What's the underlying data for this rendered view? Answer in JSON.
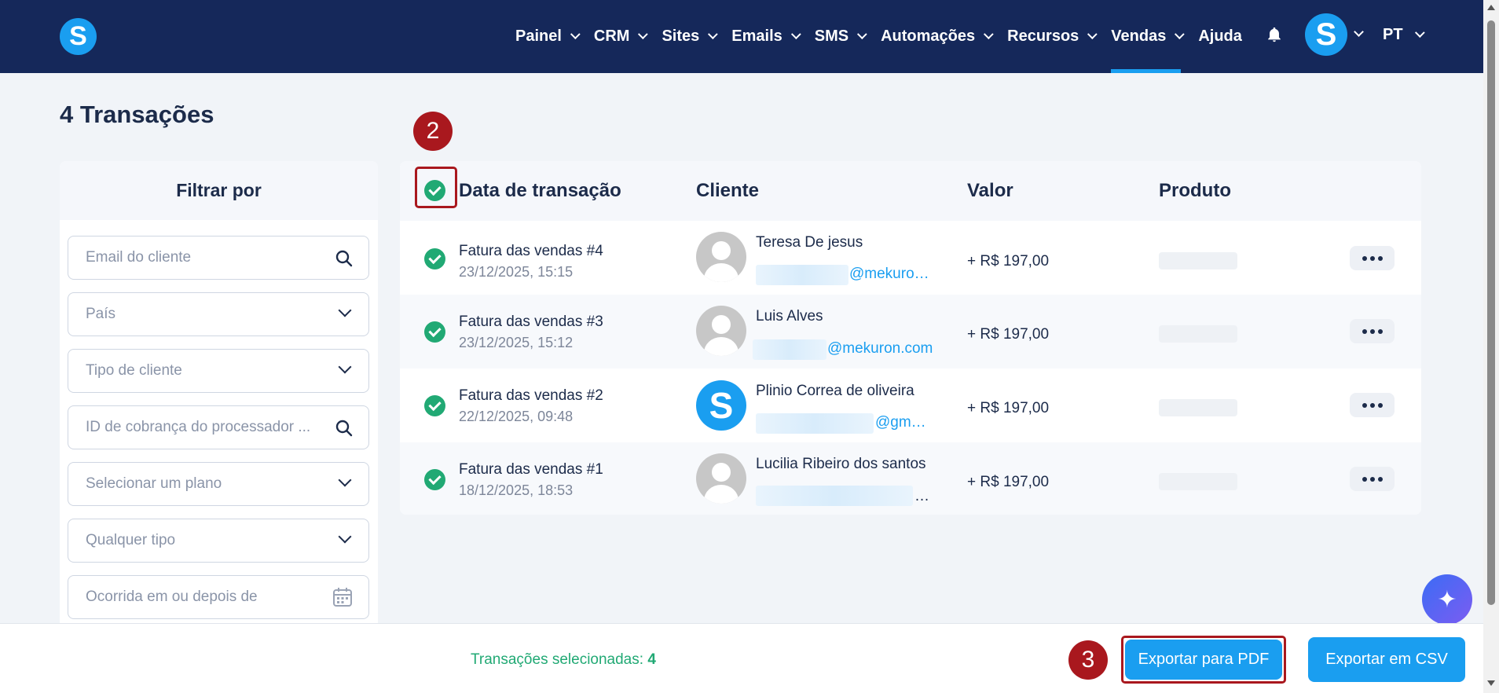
{
  "app": {
    "logo_letter": "S"
  },
  "nav": {
    "items": [
      {
        "label": "Painel",
        "has_menu": true
      },
      {
        "label": "CRM",
        "has_menu": true
      },
      {
        "label": "Sites",
        "has_menu": true
      },
      {
        "label": "Emails",
        "has_menu": true
      },
      {
        "label": "SMS",
        "has_menu": true
      },
      {
        "label": "Automações",
        "has_menu": true
      },
      {
        "label": "Recursos",
        "has_menu": true
      },
      {
        "label": "Vendas",
        "has_menu": true,
        "active": true
      },
      {
        "label": "Ajuda",
        "has_menu": false
      }
    ],
    "avatar_letter": "S",
    "language": "PT"
  },
  "page": {
    "title": "4 Transações"
  },
  "filter": {
    "heading": "Filtrar por",
    "fields": [
      {
        "placeholder": "Email do cliente",
        "icon": "search-icon"
      },
      {
        "placeholder": "País",
        "icon": "chevron-down-icon"
      },
      {
        "placeholder": "Tipo de cliente",
        "icon": "chevron-down-icon"
      },
      {
        "placeholder": "ID de cobrança do processador ...",
        "icon": "search-icon"
      },
      {
        "placeholder": "Selecionar um plano",
        "icon": "chevron-down-icon"
      },
      {
        "placeholder": "Qualquer tipo",
        "icon": "chevron-down-icon"
      },
      {
        "placeholder": "Ocorrida em ou depois de",
        "icon": "calendar-icon"
      }
    ]
  },
  "table": {
    "headers": {
      "date": "Data de transação",
      "client": "Cliente",
      "value": "Valor",
      "product": "Produto"
    },
    "rows": [
      {
        "title": "Fatura das vendas #4",
        "date": "23/12/2025, 15:15",
        "client_name": "Teresa De jesus",
        "client_email": "@mekuro…",
        "avatar": "placeholder",
        "value": "+ R$ 197,00"
      },
      {
        "title": "Fatura das vendas #3",
        "date": "23/12/2025, 15:12",
        "client_name": "Luis Alves",
        "client_email": "@mekuron.com",
        "avatar": "placeholder",
        "value": "+ R$ 197,00"
      },
      {
        "title": "Fatura das vendas #2",
        "date": "22/12/2025, 09:48",
        "client_name": "Plinio Correa de oliveira",
        "client_email": "@gm…",
        "avatar": "S",
        "value": "+ R$ 197,00"
      },
      {
        "title": "Fatura das vendas #1",
        "date": "18/12/2025, 18:53",
        "client_name": "Lucilia Ribeiro dos santos",
        "client_email": "…",
        "avatar": "placeholder",
        "value": "+ R$ 197,00"
      }
    ]
  },
  "markers": {
    "step2": "2",
    "step3": "3"
  },
  "bottom": {
    "selected_label": "Transações selecionadas:",
    "selected_count": "4",
    "export_pdf": "Exportar para PDF",
    "export_csv": "Exportar em CSV"
  },
  "colors": {
    "nav_bg": "#15285a",
    "accent": "#1a9ef0",
    "success": "#21a974",
    "marker": "#a9181e"
  }
}
